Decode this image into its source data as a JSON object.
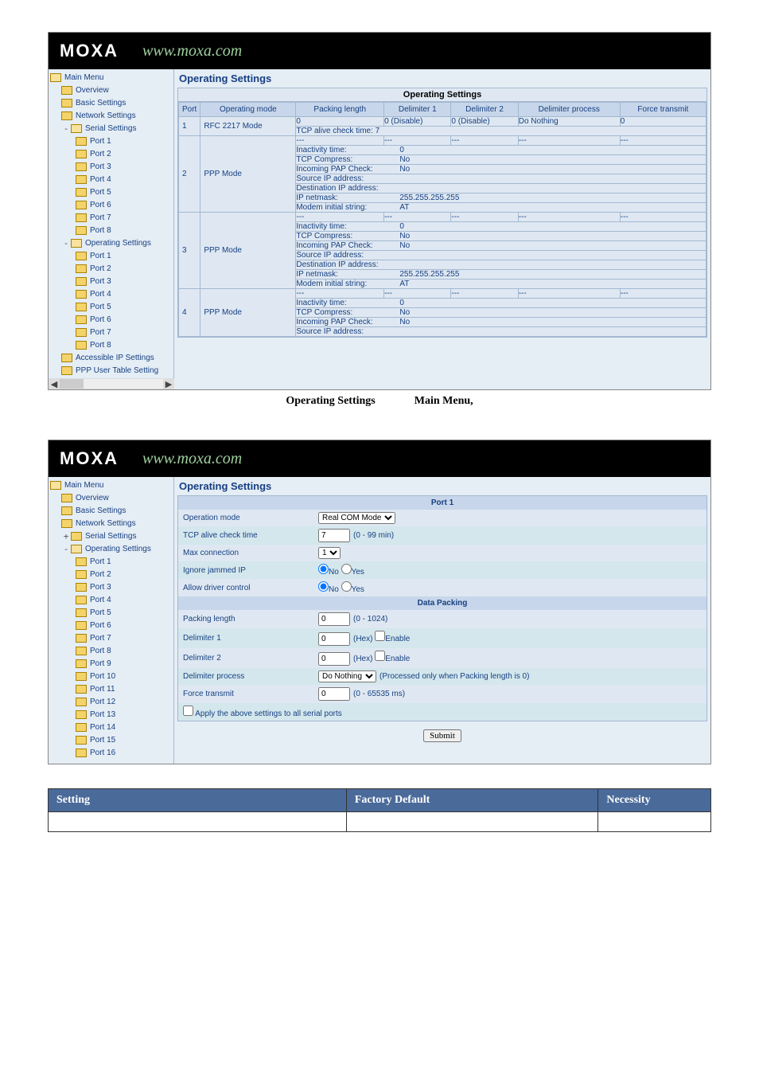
{
  "logo_text": "MOXA",
  "url_text": "www.moxa.com",
  "screenshot1": {
    "page_title": "Operating Settings",
    "section_title": "Operating Settings",
    "nav": {
      "root": "Main Menu",
      "items": [
        "Overview",
        "Basic Settings",
        "Network Settings"
      ],
      "serial_group": "Serial Settings",
      "ports_a": [
        "Port 1",
        "Port 2",
        "Port 3",
        "Port 4",
        "Port 5",
        "Port 6",
        "Port 7",
        "Port 8"
      ],
      "op_group": "Operating Settings",
      "ports_b": [
        "Port 1",
        "Port 2",
        "Port 3",
        "Port 4",
        "Port 5",
        "Port 6",
        "Port 7",
        "Port 8"
      ],
      "tail": [
        "Accessible IP Settings",
        "PPP User Table Setting"
      ]
    },
    "columns": [
      "Port",
      "Operating mode",
      "Packing length",
      "Delimiter 1",
      "Delimiter 2",
      "Delimiter process",
      "Force transmit"
    ],
    "rows": [
      {
        "port": "1",
        "mode": "RFC 2217 Mode",
        "top": [
          "0",
          "0 (Disable)",
          "0 (Disable)",
          "Do Nothing",
          "0"
        ],
        "sub": "TCP alive check time: 7"
      },
      {
        "port": "2",
        "mode": "PPP Mode",
        "top": [
          "---",
          "---",
          "---",
          "---",
          "---"
        ],
        "details": [
          [
            "Inactivity time:",
            "0"
          ],
          [
            "TCP Compress:",
            "No"
          ],
          [
            "Incoming PAP Check:",
            "No"
          ],
          [
            "Source IP address:",
            ""
          ],
          [
            "Destination IP address:",
            ""
          ],
          [
            "IP netmask:",
            "255.255.255.255"
          ],
          [
            "Modem initial string:",
            "AT"
          ]
        ]
      },
      {
        "port": "3",
        "mode": "PPP Mode",
        "top": [
          "---",
          "---",
          "---",
          "---",
          "---"
        ],
        "details": [
          [
            "Inactivity time:",
            "0"
          ],
          [
            "TCP Compress:",
            "No"
          ],
          [
            "Incoming PAP Check:",
            "No"
          ],
          [
            "Source IP address:",
            ""
          ],
          [
            "Destination IP address:",
            ""
          ],
          [
            "IP netmask:",
            "255.255.255.255"
          ],
          [
            "Modem initial string:",
            "AT"
          ]
        ]
      },
      {
        "port": "4",
        "mode": "PPP Mode",
        "top": [
          "---",
          "---",
          "---",
          "---",
          "---"
        ],
        "details": [
          [
            "Inactivity time:",
            "0"
          ],
          [
            "TCP Compress:",
            "No"
          ],
          [
            "Incoming PAP Check:",
            "No"
          ],
          [
            "Source IP address:",
            ""
          ]
        ]
      }
    ]
  },
  "caption_left": "Operating Settings",
  "caption_right": "Main Menu,",
  "screenshot2": {
    "page_title": "Operating Settings",
    "port_title": "Port 1",
    "nav": {
      "root": "Main Menu",
      "items": [
        "Overview",
        "Basic Settings",
        "Network Settings"
      ],
      "serial_group": "Serial Settings",
      "op_group": "Operating Settings",
      "ports": [
        "Port 1",
        "Port 2",
        "Port 3",
        "Port 4",
        "Port 5",
        "Port 6",
        "Port 7",
        "Port 8",
        "Port 9",
        "Port 10",
        "Port 11",
        "Port 12",
        "Port 13",
        "Port 14",
        "Port 15",
        "Port 16"
      ]
    },
    "fields": {
      "operation_mode_label": "Operation mode",
      "operation_mode_value": "Real COM Mode",
      "tcp_alive_label": "TCP alive check time",
      "tcp_alive_value": "7",
      "tcp_alive_range": "(0 - 99 min)",
      "max_conn_label": "Max connection",
      "max_conn_value": "1",
      "ignore_jammed_label": "Ignore jammed IP",
      "allow_driver_label": "Allow driver control",
      "radio_no": "No",
      "radio_yes": "Yes",
      "data_packing_title": "Data Packing",
      "packing_len_label": "Packing length",
      "packing_len_value": "0",
      "packing_len_range": "(0 - 1024)",
      "delim1_label": "Delimiter 1",
      "delim1_value": "0",
      "hex_label": "(Hex)",
      "enable_label": "Enable",
      "delim2_label": "Delimiter 2",
      "delim2_value": "0",
      "delim_proc_label": "Delimiter process",
      "delim_proc_value": "Do Nothing",
      "delim_proc_hint": "(Processed only when Packing length is 0)",
      "force_tx_label": "Force transmit",
      "force_tx_value": "0",
      "force_tx_range": "(0 - 65535 ms)",
      "apply_all_label": "Apply the above settings to all serial ports",
      "submit_label": "Submit"
    }
  },
  "defs_table": {
    "h1": "Setting",
    "h2": "Factory Default",
    "h3": "Necessity"
  }
}
